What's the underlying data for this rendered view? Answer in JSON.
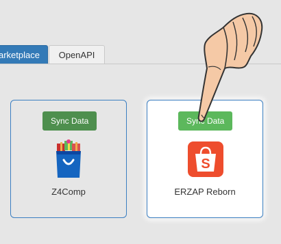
{
  "tabs": [
    {
      "label": "arketplace",
      "active": true
    },
    {
      "label": "OpenAPI",
      "active": false
    }
  ],
  "integrations": [
    {
      "name": "Z4Comp",
      "sync_label": "Sync Data",
      "logo": "shopping-bag-gift-icon"
    },
    {
      "name": "ERZAP Reborn",
      "sync_label": "Sync Data",
      "logo": "shopee-bag-icon"
    }
  ],
  "overlay": {
    "icon": "pointing-hand-icon"
  },
  "colors": {
    "accent": "#337ab7",
    "sync_button": "#5cb85c",
    "sync_button_dimmed": "#4e8f4e",
    "card_border": "#3a7ec1",
    "shopee_orange": "#ee4d2d"
  }
}
